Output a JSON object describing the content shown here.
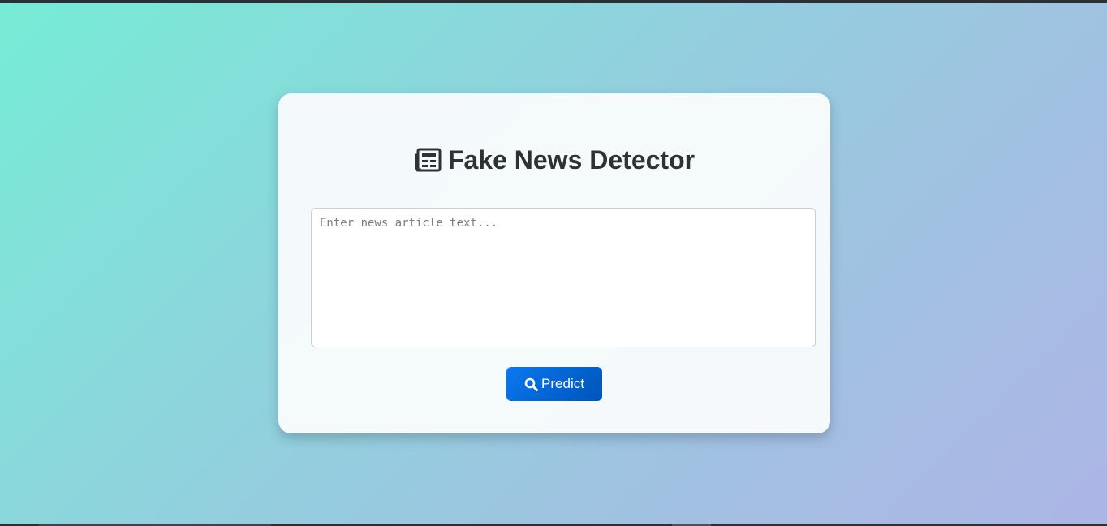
{
  "page": {
    "title": "Fake News Detector",
    "title_icon": "newspaper-icon"
  },
  "form": {
    "article_placeholder": "Enter news article text...",
    "article_value": "",
    "predict_label": "Predict",
    "predict_icon": "search-icon"
  },
  "colors": {
    "gradient_start": "#76ecd6",
    "gradient_end": "#adb5e6",
    "card_background": "#f8fbfc",
    "title_text": "#2f3134",
    "button_start": "#0a78f0",
    "button_end": "#0054b8"
  }
}
